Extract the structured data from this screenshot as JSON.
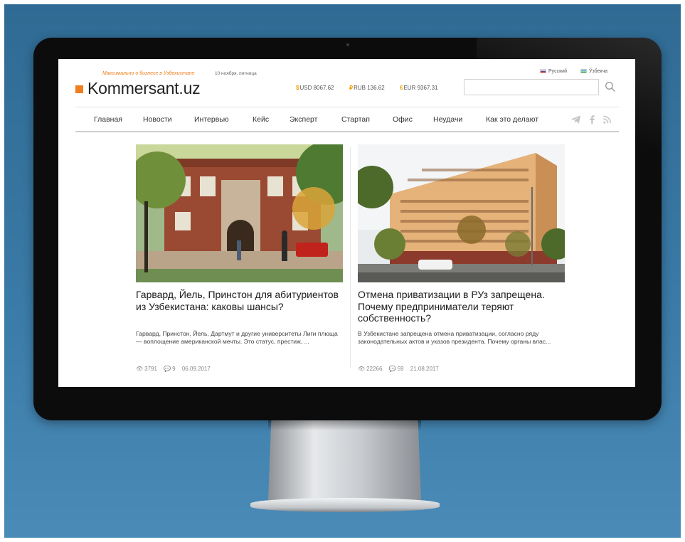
{
  "header": {
    "tagline": "Максимально о бизнесе в Узбекистане",
    "date": "10 ноября, пятница",
    "logo": "Kommersant.uz",
    "languages": {
      "ru": "Русский",
      "uz": "Ўзбекча"
    },
    "currencies": [
      {
        "symbol": "$",
        "label": "USD 8067.62"
      },
      {
        "symbol": "₽",
        "label": "RUB 136.62"
      },
      {
        "symbol": "€",
        "label": "EUR 9367.31"
      }
    ],
    "search": {
      "value": "",
      "placeholder": ""
    }
  },
  "nav": {
    "items": [
      "Главная",
      "Новости",
      "Интервью",
      "Кейс",
      "Эксперт",
      "Стартап",
      "Офис",
      "Неудачи",
      "Как это делают"
    ],
    "social": [
      "telegram-icon",
      "facebook-icon",
      "rss-icon"
    ]
  },
  "articles": [
    {
      "headline": "Гарвард, Йель, Принстон для абитуриентов из Узбекистана: каковы шансы?",
      "lead": "Гарвард, Принстон, Йель, Дартмут и другие университеты Лиги плюща — воплощение американской мечты. Это статус, престиж, ...",
      "views": "3791",
      "comments": "9",
      "date": "06.09.2017"
    },
    {
      "headline": "Отмена приватизации в РУз запрещена. Почему предприниматели теряют собственность?",
      "lead": "В Узбекистане запрещена отмена приватизации, согласно ряду законодательных актов и указов президента. Почему органы влас...",
      "views": "22266",
      "comments": "59",
      "date": "21.08.2017"
    }
  ],
  "colors": {
    "accent": "#f07e1e",
    "background": "#3a7aa6",
    "bezel": "#0c0c0c"
  }
}
